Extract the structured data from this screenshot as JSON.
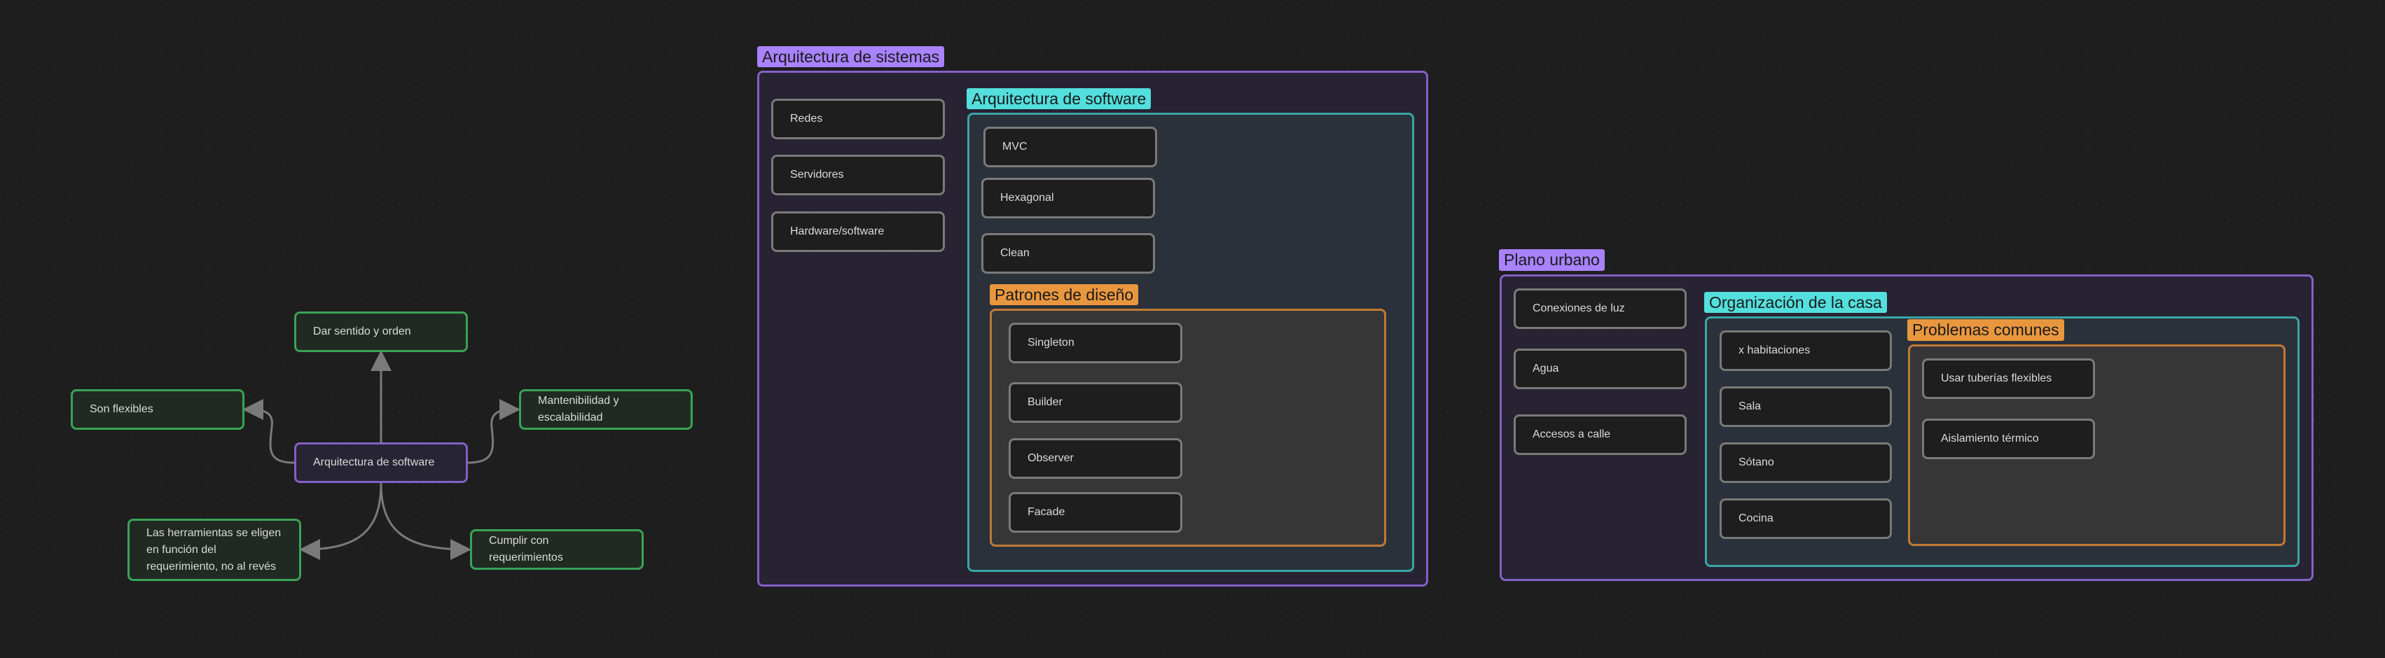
{
  "colors": {
    "background": "#1e1e1e",
    "purple": "#a882ff",
    "teal": "#53dfdd",
    "orange": "#e9973f",
    "green": "#3aa357",
    "edge": "#7a7a7a"
  },
  "mindmap": {
    "center": "Arquitectura de software",
    "branches": [
      "Dar sentido y orden",
      "Son flexibles",
      "Mantenibilidad y escalabilidad",
      "Las herramientas se eligen en función del requerimiento, no al revés",
      "Cumplir con requerimientos"
    ]
  },
  "sistemas": {
    "label": "Arquitectura de sistemas",
    "items": [
      "Redes",
      "Servidores",
      "Hardware/software"
    ],
    "software": {
      "label": "Arquitectura de software",
      "items": [
        "MVC",
        "Hexagonal",
        "Clean"
      ],
      "patrones": {
        "label": "Patrones de diseño",
        "items": [
          "Singleton",
          "Builder",
          "Observer",
          "Facade"
        ]
      }
    }
  },
  "plano": {
    "label": "Plano urbano",
    "items": [
      "Conexiones de luz",
      "Agua",
      "Accesos a calle"
    ],
    "casa": {
      "label": "Organización de la casa",
      "items": [
        "x habitaciones",
        "Sala",
        "Sótano",
        "Cocina"
      ],
      "problemas": {
        "label": "Problemas comunes",
        "items": [
          "Usar tuberías flexibles",
          "Aislamiento térmico"
        ]
      }
    }
  }
}
